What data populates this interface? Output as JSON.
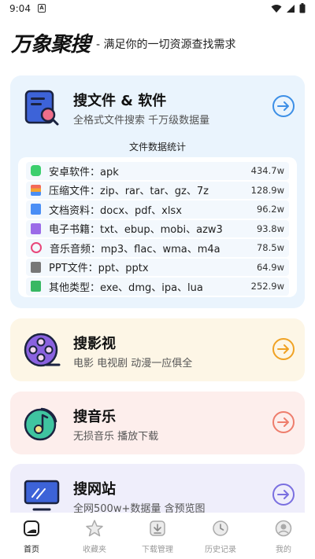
{
  "status_bar": {
    "time": "9:04",
    "badge": "A"
  },
  "header": {
    "logo": "万象聚搜",
    "slogan": "- 满足你的一切资源查找需求"
  },
  "files_card": {
    "title": "搜文件 & 软件",
    "subtitle": "全格式文件搜索 千万级数据量",
    "stats_title": "文件数据统计",
    "rows": [
      {
        "label": "安卓软件：apk",
        "count": "434.7w",
        "icon_color": "#3ccf6e"
      },
      {
        "label": "压缩文件：zip、rar、tar、gz、7z",
        "count": "128.9w",
        "icon_color": "#f3a433"
      },
      {
        "label": "文档资料：docx、pdf、xlsx",
        "count": "96.2w",
        "icon_color": "#4a8ef5"
      },
      {
        "label": "电子书籍：txt、ebup、mobi、azw3",
        "count": "93.8w",
        "icon_color": "#9b6be8"
      },
      {
        "label": "音乐音频：mp3、flac、wma、m4a",
        "count": "78.5w",
        "icon_color": "#e8467a"
      },
      {
        "label": "PPT文件：ppt、pptx",
        "count": "64.9w",
        "icon_color": "#777777"
      },
      {
        "label": "其他类型：exe、dmg、ipa、lua",
        "count": "252.9w",
        "icon_color": "#38b863"
      }
    ],
    "accent": "#3d8fe6"
  },
  "video_card": {
    "title": "搜影视",
    "subtitle": "电影 电视剧 动漫一应俱全",
    "accent": "#f0a224"
  },
  "music_card": {
    "title": "搜音乐",
    "subtitle": "无损音乐 播放下载",
    "accent": "#ee7d6c"
  },
  "web_card": {
    "title": "搜网站",
    "subtitle": "全网500w+数据量 含预览图",
    "accent": "#7a6fe0"
  },
  "nav": [
    {
      "label": "首页",
      "icon": "home-icon",
      "active": true
    },
    {
      "label": "收藏夹",
      "icon": "star-icon",
      "active": false
    },
    {
      "label": "下载管理",
      "icon": "download-icon",
      "active": false
    },
    {
      "label": "历史记录",
      "icon": "history-icon",
      "active": false
    },
    {
      "label": "我的",
      "icon": "profile-icon",
      "active": false
    }
  ]
}
